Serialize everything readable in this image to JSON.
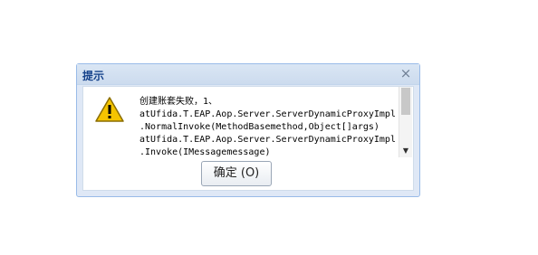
{
  "dialog": {
    "title": "提示",
    "close_icon": "close-icon",
    "warning_icon": "warning-icon",
    "message_lines": [
      "创建账套失败，1、",
      "atUfida.T.EAP.Aop.Server.ServerDynamicProxyImpl",
      ".NormalInvoke(MethodBasemethod,Object[]args)",
      "atUfida.T.EAP.Aop.Server.ServerDynamicProxyImpl",
      ".Invoke(IMessagemessage)"
    ],
    "ok_label": "确定 (O)",
    "colors": {
      "title_text": "#15428b",
      "frame_border": "#99bbe8",
      "warning_fill": "#f5c400"
    }
  }
}
